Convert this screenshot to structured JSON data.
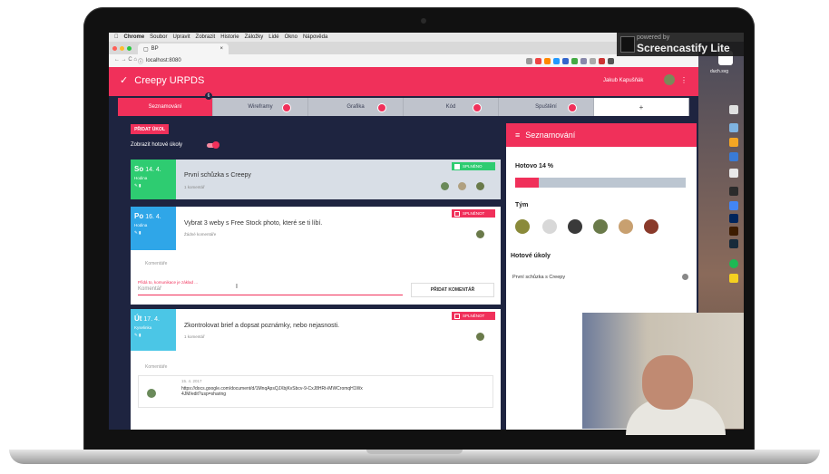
{
  "menubar": {
    "apple": "",
    "items": [
      "Chrome",
      "Soubor",
      "Upravit",
      "Zobrazit",
      "Historie",
      "Záložky",
      "Lidé",
      "Okno",
      "Nápověda"
    ]
  },
  "browser": {
    "tab_title": "BP",
    "url": "localhost:8080"
  },
  "app": {
    "title": "Creepy URPDS",
    "user_name": "Jakub Kapušňák",
    "tabs": [
      {
        "label": "Seznamování",
        "badge": "6"
      },
      {
        "label": "Wireframy"
      },
      {
        "label": "Grafika"
      },
      {
        "label": "Kód"
      },
      {
        "label": "Spuštění"
      },
      {
        "label": "+"
      }
    ],
    "add_task_label": "PŘIDAT ÚKOL",
    "show_done_label": "Zobrazit hotové úkoly",
    "tasks": [
      {
        "day": "So",
        "date": "14. 4.",
        "tag": "Hodina",
        "title": "První schůzka s Creepy",
        "comments": "1 komentář",
        "status": "SPLNĚNO"
      },
      {
        "day": "Po",
        "date": "16. 4.",
        "tag": "Hodina",
        "title": "Vybrat 3 weby s Free Stock photo, které se ti líbí.",
        "comments": "Žádné komentáře",
        "status": "SPLNĚNOT"
      },
      {
        "day": "Út",
        "date": "17. 4.",
        "tag": "Kyselinka",
        "title": "Zkontrolovat brief a dopsat poznámky, nebo nejasnosti.",
        "comments": "1 komentář",
        "status": "SPLNĚNOT"
      }
    ],
    "comments_label": "Komentáře",
    "comment_hint": "Přidá to, komunikace je základ ...",
    "comment_placeholder": "Komentář",
    "add_comment_label": "PŘIDAT KOMENTÁŘ",
    "comment_date": "15. 4. 2017",
    "comment_text": "https://docs.google.com/document/d/1MnqApsQJXbjKvSbcv-9-CxJ8HRt-iMWCromqH1Wx4JM/edit?usp=sharing"
  },
  "panel": {
    "title": "Seznamování",
    "progress_label": "Hotovo 14 %",
    "progress": 0.14,
    "team_label": "Tým",
    "done_label": "Hotové úkoly",
    "done_items": [
      "První schůzka s Creepy"
    ]
  },
  "overlay": {
    "powered_by": "powered by",
    "brand": "Screencastify Lite"
  },
  "desktop": {
    "file_label": "duch.svg"
  },
  "colors": {
    "accent": "#f0305a",
    "navy": "#1e2440",
    "green": "#2ecc71",
    "blue": "#2fa6e8",
    "teal": "#4bc6e6"
  }
}
